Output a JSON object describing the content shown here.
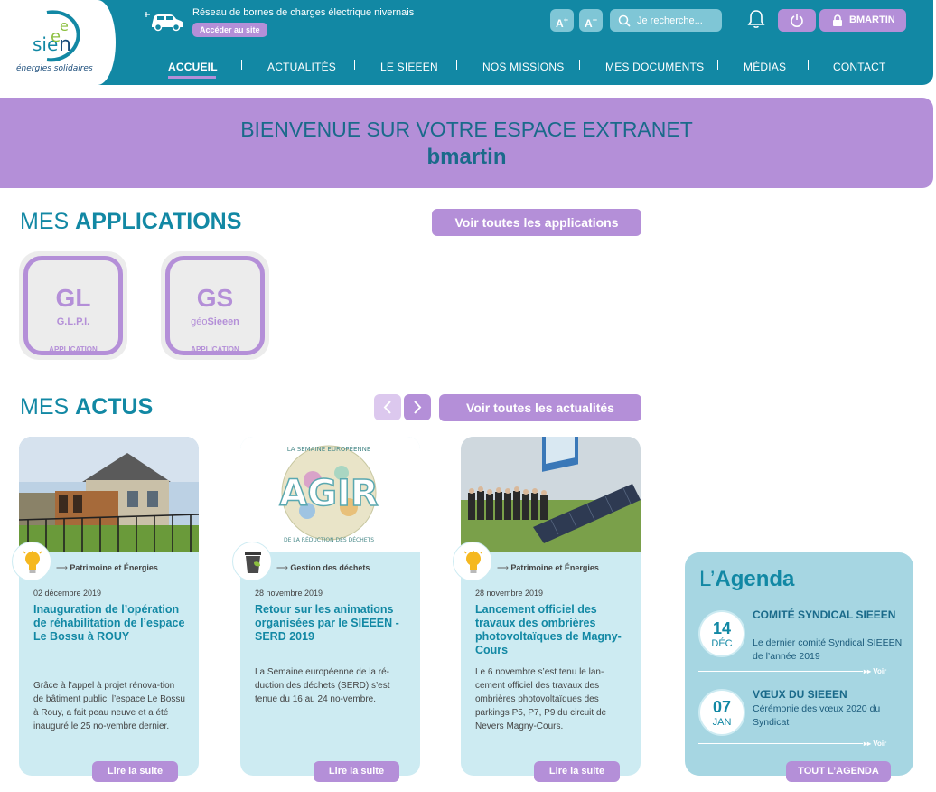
{
  "header": {
    "logo": {
      "mark_text": "sieen",
      "tagline": "énergies solidaires"
    },
    "ev_banner": {
      "text": "Réseau de bornes de charges électrique nivernais",
      "button": "Accéder au site"
    },
    "font_increase": "A",
    "font_decrease": "A",
    "search": {
      "placeholder": "Je recherche..."
    },
    "user_button": "BMARTIN",
    "nav": [
      {
        "label": "ACCUEIL",
        "active": true
      },
      {
        "label": "ACTUALITÉS",
        "active": false
      },
      {
        "label": "LE SIEEEN",
        "active": false
      },
      {
        "label": "NOS MISSIONS",
        "active": false
      },
      {
        "label": "MES DOCUMENTS",
        "active": false
      },
      {
        "label": "MÉDIAS",
        "active": false
      },
      {
        "label": "CONTACT",
        "active": false
      }
    ]
  },
  "welcome": {
    "title": "BIENVENUE SUR VOTRE ESPACE EXTRANET",
    "username": "bmartin"
  },
  "applications": {
    "title_prefix": "MES",
    "title_bold": "APPLICATIONS",
    "see_all": "Voir toutes les applications",
    "items": [
      {
        "code": "GL",
        "subtitle": "G.L.P.I.",
        "subtitle_light": "",
        "subtitle_bold": "",
        "label": "APPLICATION"
      },
      {
        "code": "GS",
        "subtitle": "",
        "subtitle_light": "géo",
        "subtitle_bold": "Sieeen",
        "label": "APPLICATION"
      }
    ]
  },
  "news": {
    "title_prefix": "MES",
    "title_bold": "ACTUS",
    "see_all": "Voir toutes les actualités",
    "items": [
      {
        "category": "Patrimoine et Énergies",
        "category_icon": "lightbulb-icon",
        "date": "02 décembre 2019",
        "title": "Inauguration de l’opération de réhabilitation de l’espace Le Bossu à ROUY",
        "text": "Grâce à l’appel à projet rénova-tion de bâtiment public, l’espace Le Bossu à Rouy, a fait peau neuve et a été inauguré le 25 no-vembre dernier.",
        "button": "Lire la suite"
      },
      {
        "category": "Gestion des déchets",
        "category_icon": "recycle-bin-icon",
        "date": "28 novembre 2019",
        "title": "Retour sur les animations organisées par le SIEEEN - SERD 2019",
        "text": "La Semaine européenne de la ré-duction des déchets (SERD) s’est tenue du 16 au 24 no-vembre.",
        "button": "Lire la suite",
        "image_text": {
          "top": "LA SEMAINE EUROPÉENNE",
          "main": "AGIR",
          "bottom": "DE LA RÉDUCTION DES DÉCHETS"
        }
      },
      {
        "category": "Patrimoine et Énergies",
        "category_icon": "lightbulb-icon",
        "date": "28 novembre 2019",
        "title": "Lancement officiel des travaux des ombrières photovoltaïques de Magny-Cours",
        "text": "Le 6 novembre s’est tenu le lan-cement officiel des travaux des ombrières photovoltaïques des parkings P5, P7, P9 du circuit de Nevers Magny-Cours.",
        "button": "Lire la suite"
      }
    ]
  },
  "agenda": {
    "title_prefix": "L’",
    "title_bold": "Agenda",
    "events": [
      {
        "day": "14",
        "month": "DÉC",
        "title": "COMITÉ SYNDICAL SIEEEN",
        "desc": "Le dernier comité Syndical SIEEEN de l’année 2019",
        "more": "Voir"
      },
      {
        "day": "07",
        "month": "JAN",
        "title": "VŒUX DU SIEEEN",
        "desc": "Cérémonie des vœux 2020 du Syndicat",
        "more": "Voir"
      }
    ],
    "button": "TOUT L’AGENDA"
  },
  "colors": {
    "primary": "#1288a4",
    "accent": "#b48fd8",
    "card_bg": "#cdebf2",
    "agenda_bg": "#a6d6e2"
  }
}
